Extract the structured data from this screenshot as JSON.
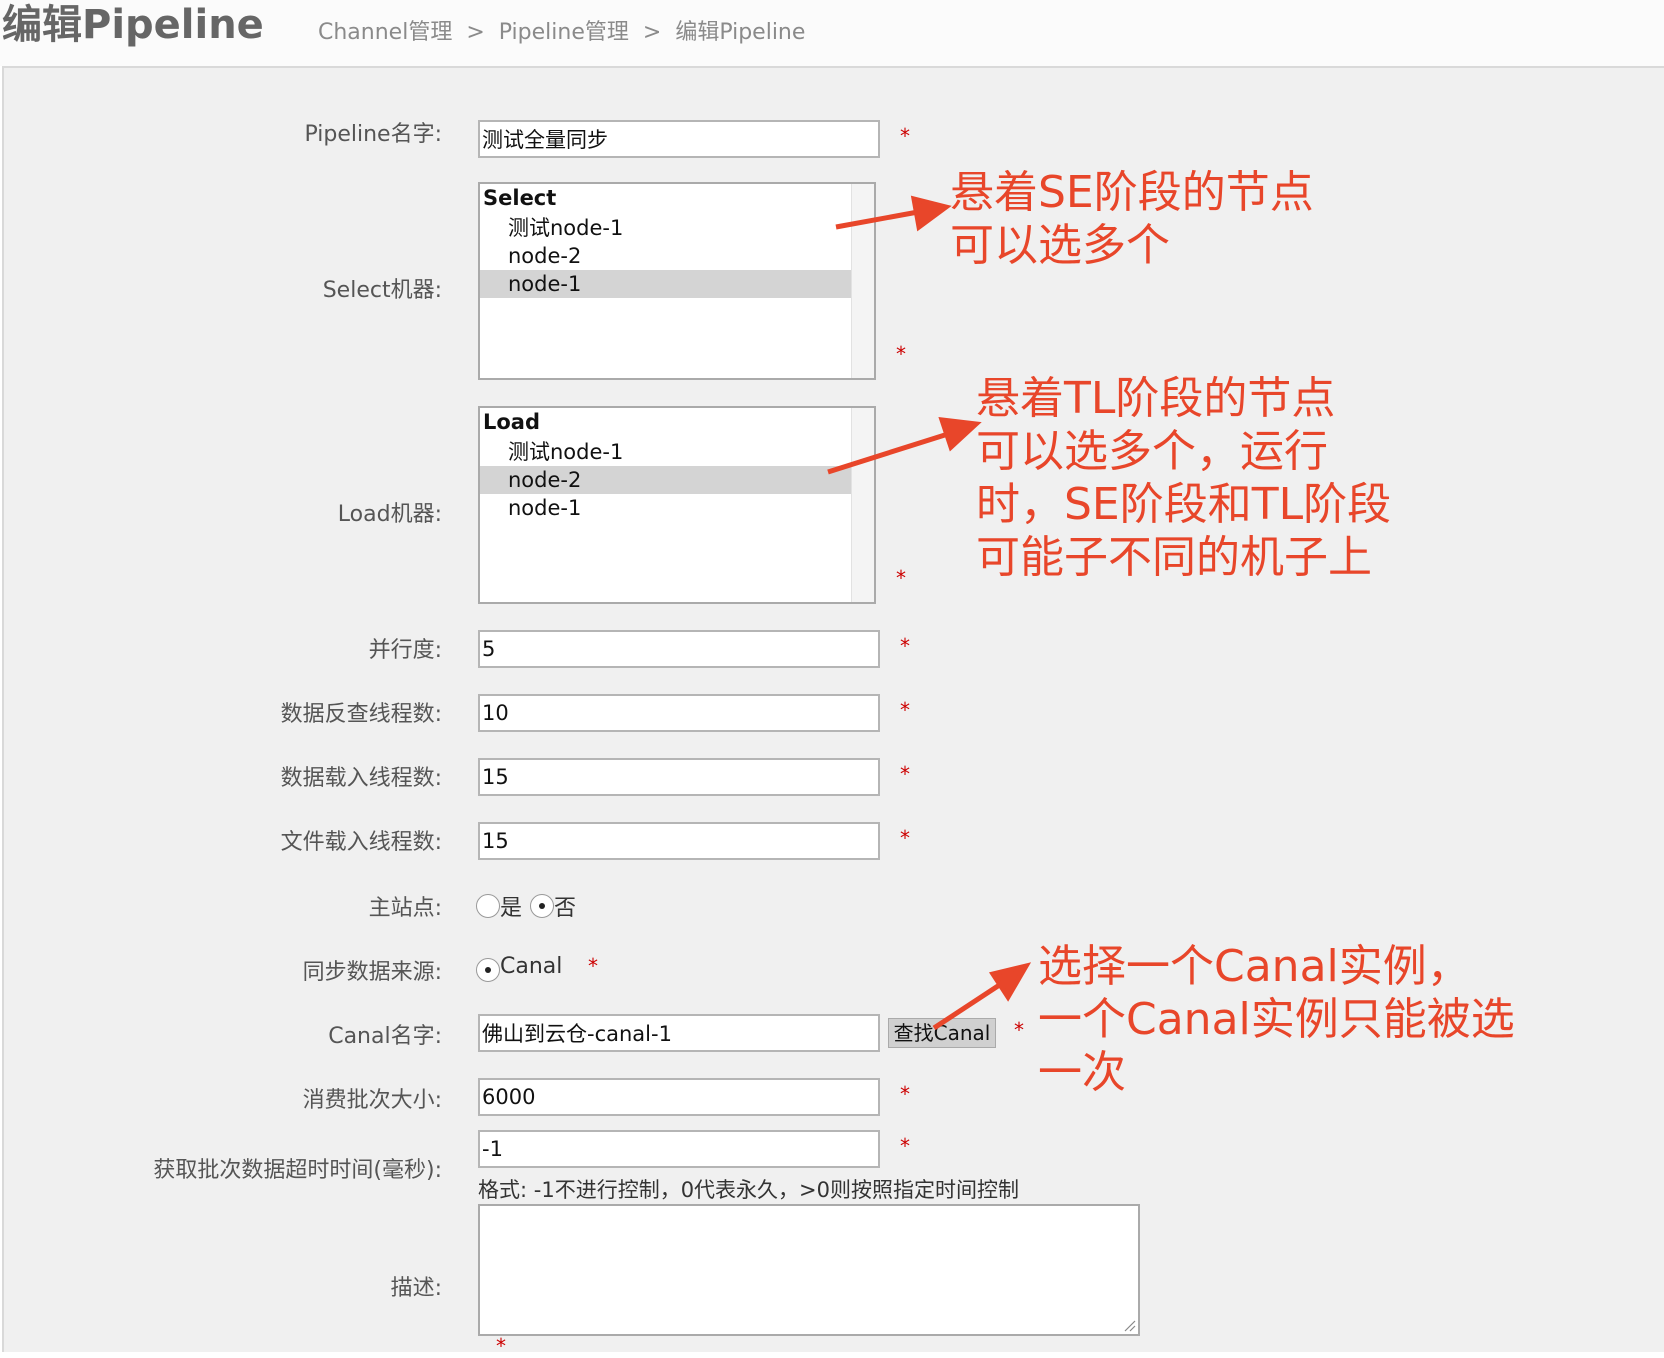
{
  "header": {
    "title": "编辑Pipeline",
    "breadcrumb": [
      "Channel管理",
      ">",
      "Pipeline管理",
      ">",
      "编辑Pipeline"
    ]
  },
  "form": {
    "pipeline_name": {
      "label": "Pipeline名字:",
      "value": "测试全量同步",
      "required": "*"
    },
    "select_nodes": {
      "label": "Select机器:",
      "group": "Select",
      "options": [
        {
          "label": "测试node-1",
          "selected": false
        },
        {
          "label": "node-2",
          "selected": false
        },
        {
          "label": "node-1",
          "selected": true
        }
      ],
      "required": "*"
    },
    "load_nodes": {
      "label": "Load机器:",
      "group": "Load",
      "options": [
        {
          "label": "测试node-1",
          "selected": false
        },
        {
          "label": "node-2",
          "selected": true
        },
        {
          "label": "node-1",
          "selected": false
        }
      ],
      "required": "*"
    },
    "parallelism": {
      "label": "并行度:",
      "value": "5",
      "required": "*"
    },
    "extract_threads": {
      "label": "数据反查线程数:",
      "value": "10",
      "required": "*"
    },
    "load_threads": {
      "label": "数据载入线程数:",
      "value": "15",
      "required": "*"
    },
    "file_load_threads": {
      "label": "文件载入线程数:",
      "value": "15",
      "required": "*"
    },
    "home_site": {
      "label": "主站点:",
      "options": [
        {
          "label": "是",
          "checked": false
        },
        {
          "label": "否",
          "checked": true
        }
      ]
    },
    "data_source": {
      "label": "同步数据来源:",
      "option": "Canal",
      "checked": true,
      "required": "*"
    },
    "canal_name": {
      "label": "Canal名字:",
      "value": "佛山到云仓-canal-1",
      "button": "查找Canal",
      "required": "*"
    },
    "batch_size": {
      "label": "消费批次大小:",
      "value": "6000",
      "required": "*"
    },
    "batch_timeout": {
      "label": "获取批次数据超时时间(毫秒):",
      "value": "-1",
      "hint": "格式: -1不进行控制，0代表永久，>0则按照指定时间控制",
      "required": "*"
    },
    "description": {
      "label": "描述:",
      "value": "",
      "required": "*"
    }
  },
  "annotations": {
    "select_note": "悬着SE阶段的节点\n可以选多个",
    "load_note": "悬着TL阶段的节点\n可以选多个，运行\n时，SE阶段和TL阶段\n可能子不同的机子上",
    "canal_note": "选择一个Canal实例，\n一个Canal实例只能被选\n一次",
    "color": "#e8462a"
  }
}
